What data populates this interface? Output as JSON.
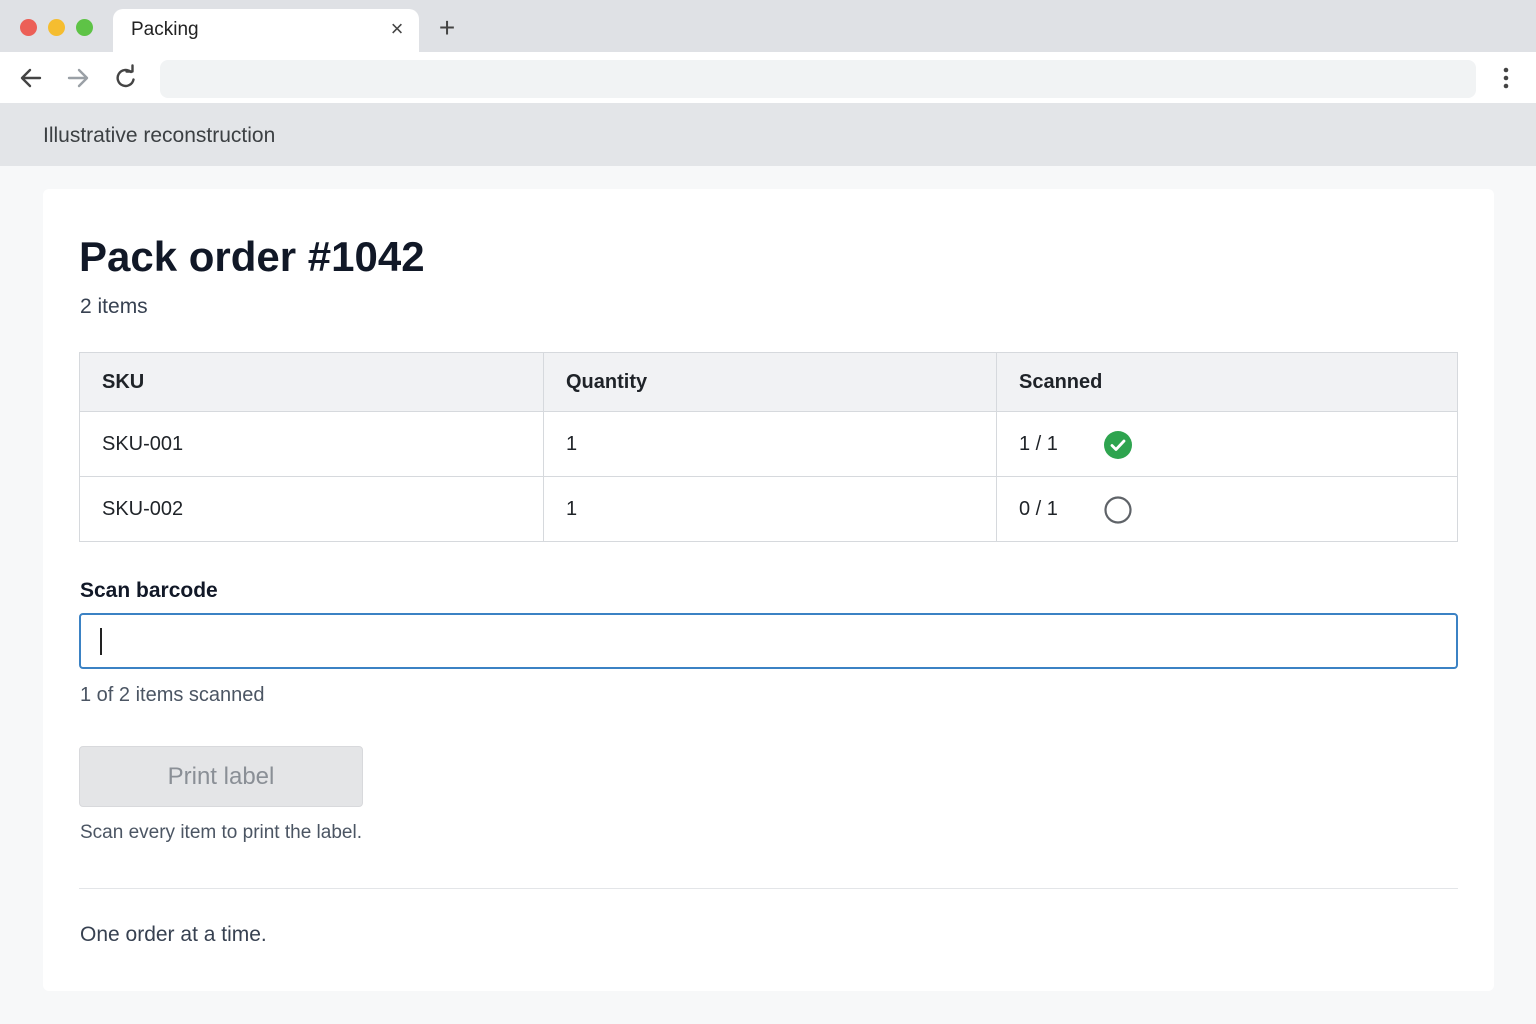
{
  "browser": {
    "tab_title": "Packing",
    "tab_close_icon": "close-icon",
    "new_tab_icon": "plus-icon",
    "address_value": ""
  },
  "banner": {
    "text": "Illustrative reconstruction"
  },
  "order": {
    "title": "Pack order #1042",
    "item_count": "2 items",
    "table": {
      "headers": [
        "SKU",
        "Quantity",
        "Scanned"
      ],
      "rows": [
        {
          "sku": "SKU-001",
          "quantity": "1",
          "scanned": "1 / 1",
          "status_icon": "check-circle-icon",
          "status_color": "#2ea44f"
        },
        {
          "sku": "SKU-002",
          "quantity": "1",
          "scanned": "0 / 1",
          "status_icon": "empty-circle-icon",
          "status_color": "#5f6368"
        }
      ]
    },
    "scan": {
      "label": "Scan barcode",
      "value": "",
      "progress": "1 of 2 items scanned"
    },
    "print_button": {
      "label": "Print label",
      "disabled": true,
      "help": "Scan every item to print the label."
    },
    "footer_note": "One order at a time."
  },
  "colors": {
    "input_focus": "#3b82c4",
    "success": "#2ea44f"
  }
}
